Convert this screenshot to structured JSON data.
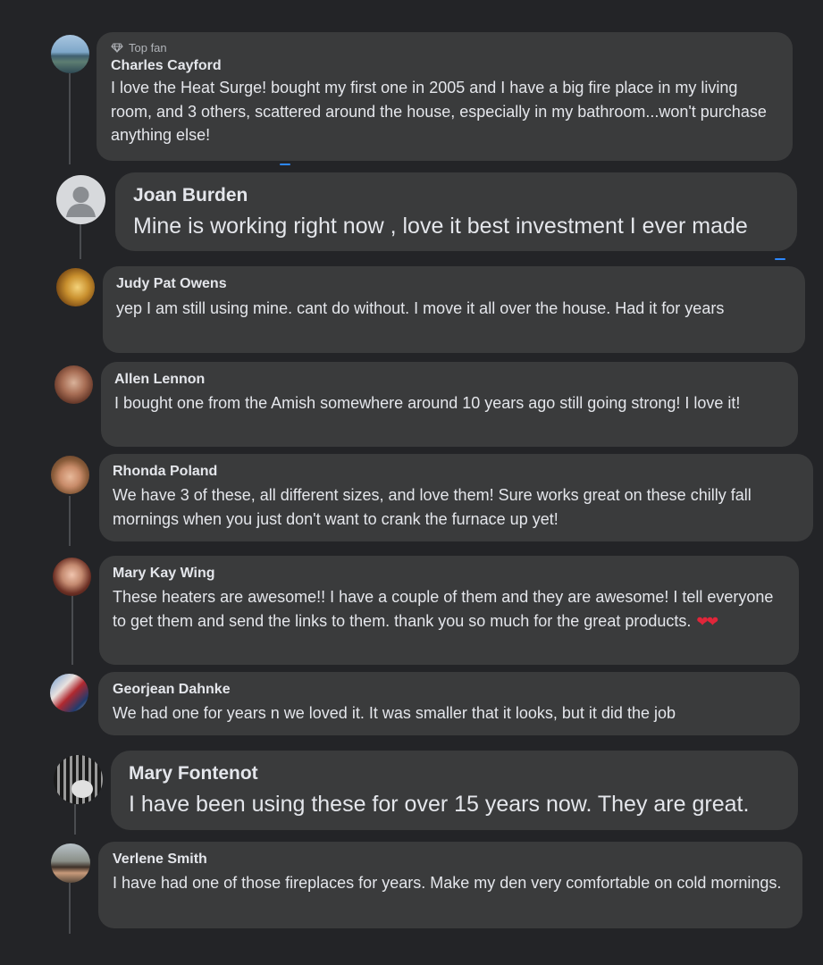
{
  "comments": [
    {
      "badge": "Top fan",
      "name": "Charles Cayford",
      "text": "I love the Heat Surge! bought my first one in 2005 and I have a big fire place in my living room, and 3 others, scattered around the house, especially in my bathroom...won't purchase anything else!"
    },
    {
      "name": "Joan Burden",
      "text": "Mine is working right now , love it best investment I ever made"
    },
    {
      "name": "Judy Pat Owens",
      "text": "yep I am still using mine. cant do without. I move it all over the house. Had it for years"
    },
    {
      "name": "Allen Lennon",
      "text": "I bought one from the Amish somewhere around 10 years ago still going strong! I love it!"
    },
    {
      "name": "Rhonda Poland",
      "text": "We have 3 of these, all different sizes, and love them! Sure works great on these chilly fall mornings when you just don't want to crank the furnace up yet!"
    },
    {
      "name": "Mary Kay Wing",
      "text": "These heaters are awesome!! I have a couple of them and they are awesome! I tell everyone to get them and send the links to them. thank you so much for the great products.",
      "emoji": "❤❤"
    },
    {
      "name": "Georjean Dahnke",
      "text": "We had one for years n we loved it. It was smaller that it looks, but it did the job"
    },
    {
      "name": "Mary Fontenot",
      "text": "I have been using these for over 15 years now. They are great."
    },
    {
      "name": "Verlene Smith",
      "text": "I have had one of those fireplaces for years. Make my den very comfortable on cold mornings."
    }
  ]
}
